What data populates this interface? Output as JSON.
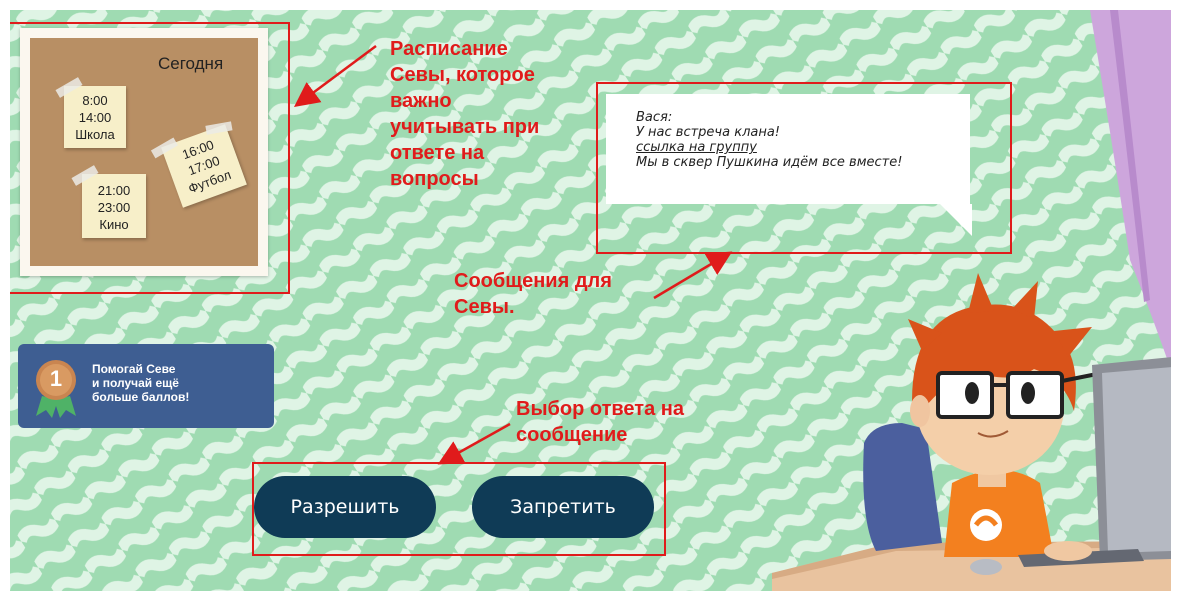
{
  "schedule": {
    "title": "Сегодня",
    "notes": [
      {
        "lines": [
          "8:00",
          "14:00",
          "Школа"
        ]
      },
      {
        "lines": [
          "16:00",
          "17:00",
          "Футбол"
        ]
      },
      {
        "lines": [
          "21:00",
          "23:00",
          "Кино"
        ]
      }
    ]
  },
  "chat": {
    "sender": "Вася:",
    "line1": "У нас встреча клана!",
    "link": "ссылка на группу",
    "line2": "Мы в сквер Пушкина идём все вместе!"
  },
  "badge": {
    "number": "1",
    "line1": "Помогай Севе",
    "line2": "и получай ещё",
    "line3": "больше баллов!"
  },
  "actions": {
    "allow": "Разрешить",
    "deny": "Запретить"
  },
  "annotations": {
    "schedule": [
      "Расписание",
      "Севы, которое",
      "важно",
      "учитывать при",
      "ответе на",
      "вопросы"
    ],
    "messages": [
      "Сообщения для",
      "Севы."
    ],
    "answer": [
      "Выбор ответа на",
      "сообщение"
    ]
  },
  "colors": {
    "background": "#b6e4c3",
    "wave": "#d9f2e0",
    "annotation": "#e01b1b",
    "button": "#0f3b56",
    "badge": "#3e5e92"
  }
}
